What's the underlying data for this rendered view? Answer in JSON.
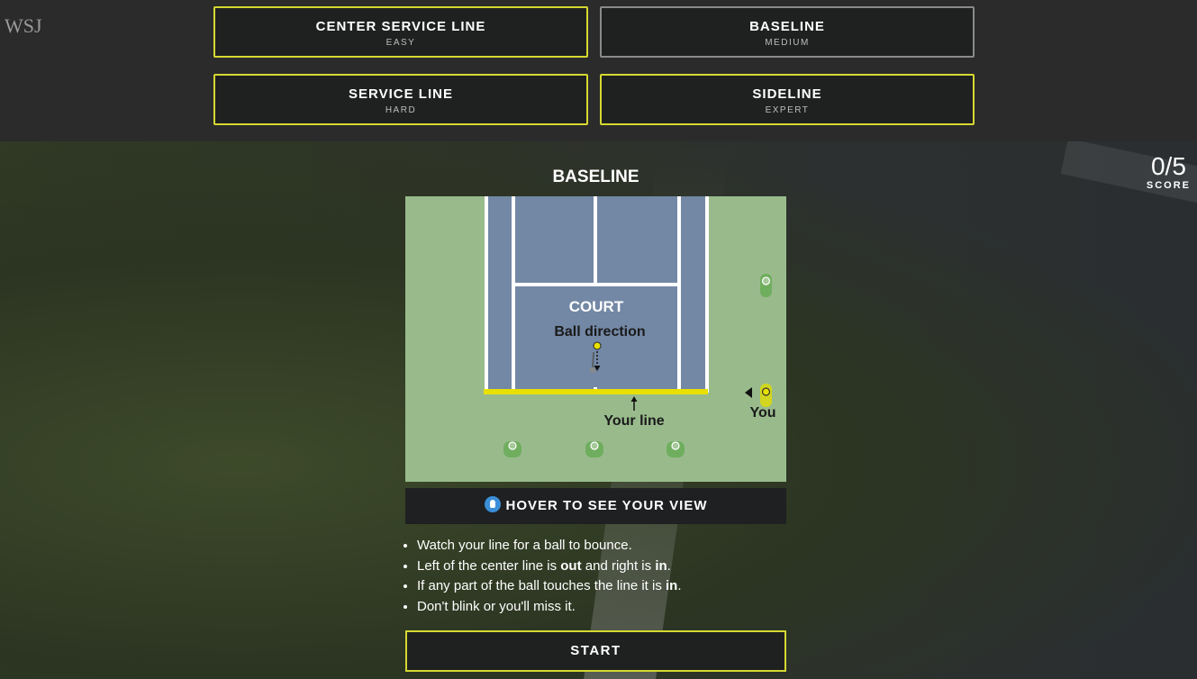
{
  "brand": {
    "logo": "WSJ"
  },
  "levels": [
    {
      "name": "CENTER SERVICE LINE",
      "difficulty": "EASY"
    },
    {
      "name": "BASELINE",
      "difficulty": "MEDIUM"
    },
    {
      "name": "SERVICE LINE",
      "difficulty": "HARD"
    },
    {
      "name": "SIDELINE",
      "difficulty": "EXPERT"
    }
  ],
  "selected_level": "BASELINE",
  "score": {
    "value": "0/5",
    "label": "SCORE"
  },
  "game": {
    "title": "BASELINE",
    "diagram": {
      "court_label": "COURT",
      "ball_direction_label": "Ball direction",
      "your_line_label": "Your line",
      "you_label": "You",
      "colors": {
        "grass": "#99bb8c",
        "court": "#7388a5",
        "line": "#ffffff",
        "highlight": "#e8e000",
        "marker": "#6fae5e"
      }
    },
    "hover_label": "HOVER TO SEE YOUR VIEW",
    "tips": {
      "t1": "Watch your line for a ball to bounce.",
      "t2_a": "Left of the center line is ",
      "t2_b": "out",
      "t2_c": " and right is ",
      "t2_d": "in",
      "t2_e": ".",
      "t3_a": "If any part of the ball touches the line it is ",
      "t3_b": "in",
      "t3_c": ".",
      "t4": "Don't blink or you'll miss it."
    },
    "start_label": "START"
  }
}
